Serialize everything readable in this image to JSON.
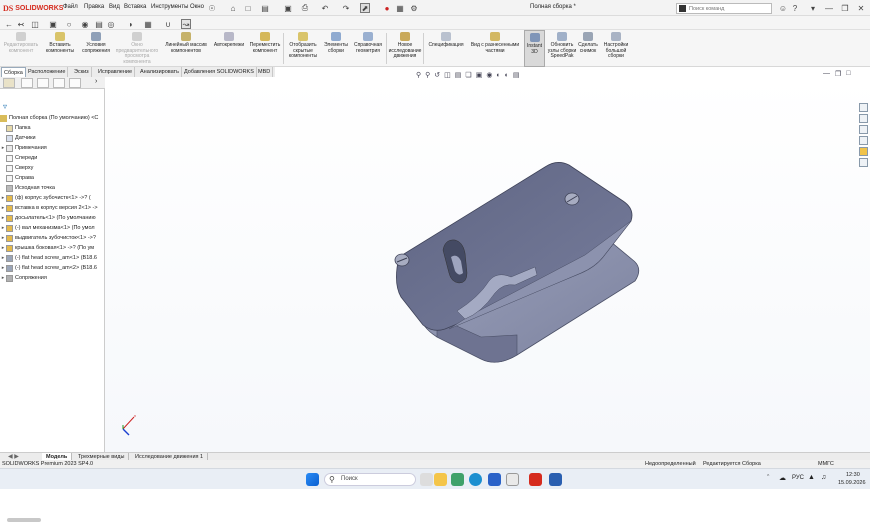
{
  "titlebar": {
    "brand_ds": "DS",
    "brand_solid": "SOLID",
    "brand_works": "WORKS",
    "menus": [
      "Файл",
      "Правка",
      "Вид",
      "Вставка",
      "Инструменты",
      "Окно"
    ],
    "document_title": "Полная сборка *",
    "search_placeholder": "Поиск команд"
  },
  "ribbon": {
    "buttons": [
      {
        "label": "Редактировать компонент",
        "enabled": false
      },
      {
        "label": "Вставить компоненты",
        "enabled": true
      },
      {
        "label": "Условия сопряжения",
        "enabled": true
      },
      {
        "label": "Окно предварительного просмотра компонента",
        "enabled": false
      },
      {
        "label": "Линейный массив компонентов",
        "enabled": true
      },
      {
        "label": "Автокрепежи",
        "enabled": true
      },
      {
        "label": "Переместить компонент",
        "enabled": true
      },
      {
        "label": "Отобразить скрытые компоненты",
        "enabled": true
      },
      {
        "label": "Элементы сборки",
        "enabled": true
      },
      {
        "label": "Справочная геометрия",
        "enabled": true
      },
      {
        "label": "Новое исследование движения",
        "enabled": true
      },
      {
        "label": "Спецификация",
        "enabled": true
      },
      {
        "label": "Вид с разнесенными частями",
        "enabled": true
      },
      {
        "label": "Instant 3D",
        "enabled": true,
        "active": true
      },
      {
        "label": "Обновить узлы сборки SpeedPak",
        "enabled": true
      },
      {
        "label": "Сделать снимок",
        "enabled": true
      },
      {
        "label": "Настройки большой сборки",
        "enabled": true
      }
    ]
  },
  "command_tabs": [
    "Сборка",
    "Расположение",
    "Эскиз",
    "Исправление",
    "Анализировать",
    "Добавления SOLIDWORKS",
    "MBD"
  ],
  "feature_tree": {
    "root": "Полная сборка (По умолчанию) <С",
    "items": [
      {
        "label": "Папка",
        "expandable": false
      },
      {
        "label": "Датчики",
        "expandable": false
      },
      {
        "label": "Примечания",
        "expandable": true
      },
      {
        "label": "Спереди",
        "expandable": false
      },
      {
        "label": "Сверху",
        "expandable": false
      },
      {
        "label": "Справа",
        "expandable": false
      },
      {
        "label": "Исходная точка",
        "expandable": false
      },
      {
        "label": "(ф) корпус зубочистк<1> ->? (",
        "expandable": true
      },
      {
        "label": "вставка в корпус версия 2<1> ->",
        "expandable": true
      },
      {
        "label": "досылатель<1> (По умолчанию",
        "expandable": true
      },
      {
        "label": "(-) вал механизма<1> (По умол",
        "expandable": true
      },
      {
        "label": "выдвигатель зубочисток<1> ->?",
        "expandable": true
      },
      {
        "label": "крышка боковая<1> ->? (По ум",
        "expandable": true
      },
      {
        "label": "(-) flat head screw_am<1> (B18.6",
        "expandable": true
      },
      {
        "label": "(-) flat head screw_am<2> (B18.6",
        "expandable": true
      },
      {
        "label": "Сопряжения",
        "expandable": true
      }
    ]
  },
  "bottom_tabs": [
    "Модель",
    "Трехмерные виды",
    "Исследование движения 1"
  ],
  "status": {
    "product": "SOLIDWORKS Premium 2023 SP4.0",
    "state": "Недоопределенный",
    "mode": "Редактируется Сборка",
    "units": "ММГС"
  },
  "taskbar": {
    "search_label": "Поиск",
    "language": "РУС",
    "time": "12:30",
    "date": "15.09.2026"
  },
  "colors": {
    "brand_red": "#d52b1e",
    "model_face": "#8e94b0",
    "model_top": "#6c7290",
    "selection_blue": "#1a3fd0"
  }
}
